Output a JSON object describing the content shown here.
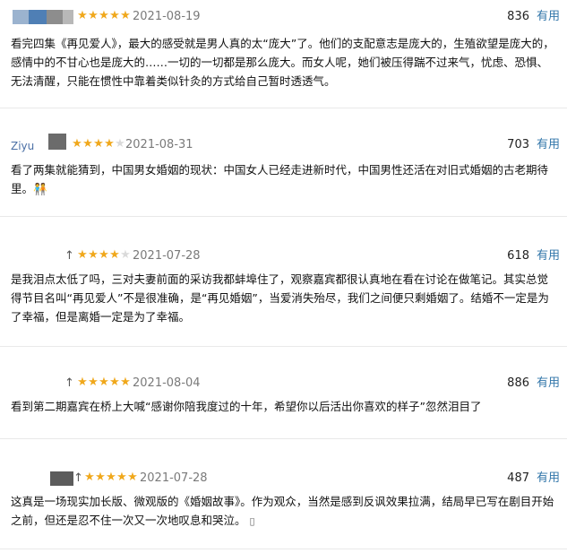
{
  "colors": {
    "star_on": "#f0a81c",
    "star_off": "#dadada",
    "useful_link": "#3377aa",
    "date_text": "#7a7a7a",
    "divider": "#e9e9e9"
  },
  "useful_label": "有用",
  "reviews": [
    {
      "rating": 5,
      "date": "2021-08-19",
      "votes": "836",
      "text": "看完四集《再见爱人》，最大的感受就是男人真的太“庞大”了。他们的支配意志是庞大的，生殖欲望是庞大的，感情中的不甘心也是庞大的……一切的一切都是那么庞大。而女人呢，她们被压得踹不过来气，忧虑、恐惧、无法清醒，只能在惯性中靠着类似针灸的方式给自己暂时透透气。"
    },
    {
      "rating": 4,
      "date": "2021-08-31",
      "votes": "703",
      "username_fragment": "Ziyu",
      "text": "看了两集就能猜到，中国男女婚姻的现状：中国女人已经走进新时代，中国男性还活在对旧式婚姻的古老期待里。🧑‍🤝‍🧑"
    },
    {
      "rating": 4,
      "date": "2021-07-28",
      "votes": "618",
      "text": "是我泪点太低了吗，三对夫妻前面的采访我都蚌埠住了，观察嘉宾都很认真地在看在讨论在做笔记。其实总觉得节目名叫“再见爱人”不是很准确，是“再见婚姻”，当爱消失殆尽，我们之间便只剩婚姻了。结婚不一定是为了幸福，但是离婚一定是为了幸福。"
    },
    {
      "rating": 5,
      "date": "2021-08-04",
      "votes": "886",
      "text": "看到第二期嘉宾在桥上大喊“感谢你陪我度过的十年，希望你以后活出你喜欢的样子”忽然泪目了"
    },
    {
      "rating": 5,
      "date": "2021-07-28",
      "votes": "487",
      "text": "这真是一场现实加长版、微观版的《婚姻故事》。作为观众，当然是感到反讽效果拉满，结局早已写在剧目开始之前，但还是忍不住一次又一次地叹息和哭泣。"
    }
  ]
}
